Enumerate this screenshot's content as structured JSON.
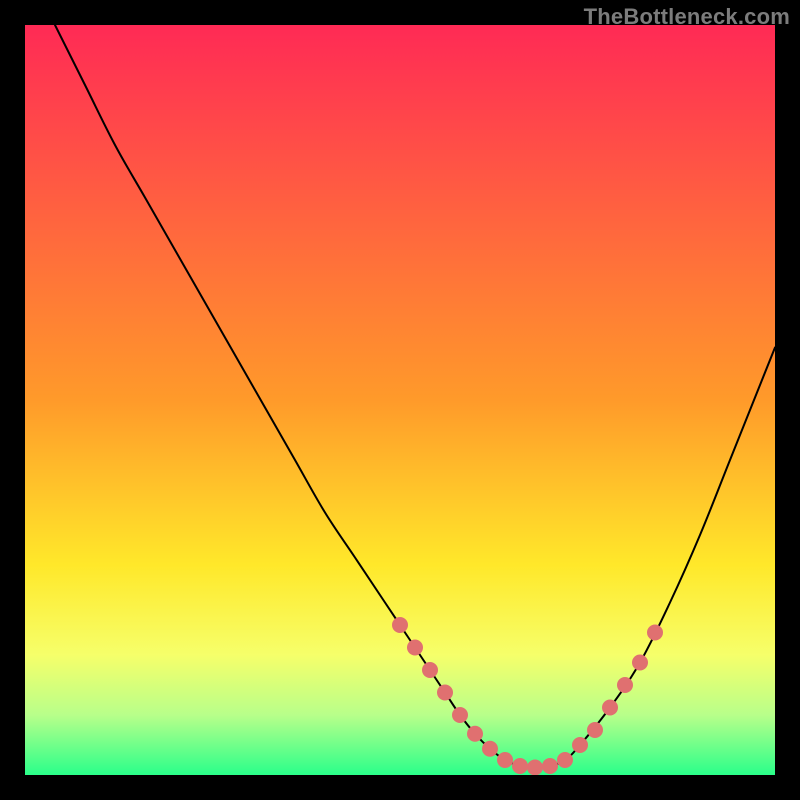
{
  "watermark": "TheBottleneck.com",
  "colors": {
    "bg": "#000000",
    "grad_top": "#ff2a55",
    "grad_mid1": "#ff9a2a",
    "grad_mid2": "#ffe82a",
    "grad_low1": "#f6ff6a",
    "grad_low2": "#b8ff8a",
    "grad_bottom": "#2aff8a",
    "curve": "#000000",
    "dot": "#e07070"
  },
  "chart_data": {
    "type": "line",
    "title": "",
    "xlabel": "",
    "ylabel": "",
    "xlim": [
      0,
      100
    ],
    "ylim": [
      0,
      100
    ],
    "series": [
      {
        "name": "bottleneck-curve",
        "x": [
          4,
          8,
          12,
          16,
          20,
          24,
          28,
          32,
          36,
          40,
          44,
          48,
          50,
          52,
          54,
          56,
          58,
          60,
          62,
          64,
          66,
          68,
          70,
          72,
          74,
          78,
          82,
          86,
          90,
          94,
          98,
          100
        ],
        "y": [
          100,
          92,
          84,
          77,
          70,
          63,
          56,
          49,
          42,
          35,
          29,
          23,
          20,
          17,
          14,
          11,
          8,
          5.5,
          3.5,
          2,
          1.2,
          1,
          1.2,
          2,
          4,
          9,
          15,
          23,
          32,
          42,
          52,
          57
        ]
      }
    ],
    "points": {
      "name": "highlight-dots",
      "x": [
        50,
        52,
        54,
        56,
        58,
        60,
        62,
        64,
        66,
        68,
        70,
        72,
        74,
        76,
        78,
        80,
        82,
        84
      ],
      "y": [
        20,
        17,
        14,
        11,
        8,
        5.5,
        3.5,
        2,
        1.2,
        1,
        1.2,
        2,
        4,
        6,
        9,
        12,
        15,
        19
      ]
    },
    "gradient_stops": [
      {
        "pct": 0,
        "key": "grad_top"
      },
      {
        "pct": 50,
        "key": "grad_mid1"
      },
      {
        "pct": 72,
        "key": "grad_mid2"
      },
      {
        "pct": 84,
        "key": "grad_low1"
      },
      {
        "pct": 92,
        "key": "grad_low2"
      },
      {
        "pct": 100,
        "key": "grad_bottom"
      }
    ]
  }
}
